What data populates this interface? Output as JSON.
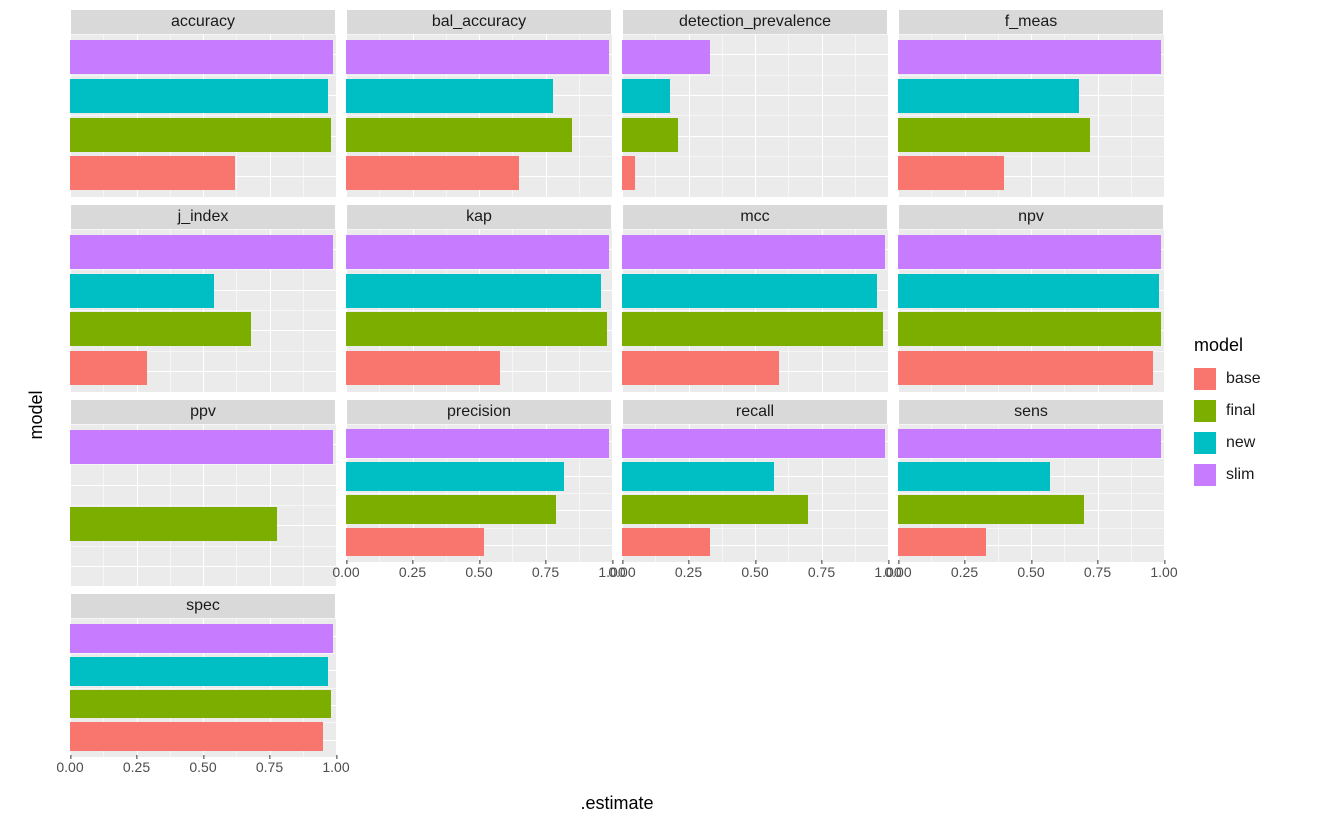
{
  "axis": {
    "x_label": ".estimate",
    "y_label": "model",
    "x_ticks": [
      "0.00",
      "0.25",
      "0.50",
      "0.75",
      "1.00"
    ]
  },
  "legend": {
    "title": "model",
    "items": [
      {
        "name": "base",
        "color": "#F8766D"
      },
      {
        "name": "final",
        "color": "#7CAE00"
      },
      {
        "name": "new",
        "color": "#00BFC4"
      },
      {
        "name": "slim",
        "color": "#C77CFF"
      }
    ]
  },
  "models_order": [
    "base",
    "final",
    "new",
    "slim"
  ],
  "colors": {
    "base": "#F8766D",
    "final": "#7CAE00",
    "new": "#00BFC4",
    "slim": "#C77CFF"
  },
  "chart_data": {
    "type": "bar",
    "facet_layout": {
      "rows": 4,
      "cols": 4
    },
    "xlim": [
      0.0,
      1.0
    ],
    "facets": [
      {
        "title": "accuracy",
        "values": {
          "base": 0.62,
          "final": 0.98,
          "new": 0.97,
          "slim": 0.99
        }
      },
      {
        "title": "bal_accuracy",
        "values": {
          "base": 0.65,
          "final": 0.85,
          "new": 0.78,
          "slim": 0.99
        }
      },
      {
        "title": "detection_prevalence",
        "values": {
          "base": 0.05,
          "final": 0.21,
          "new": 0.18,
          "slim": 0.33
        }
      },
      {
        "title": "f_meas",
        "values": {
          "base": 0.4,
          "final": 0.72,
          "new": 0.68,
          "slim": 0.99
        }
      },
      {
        "title": "j_index",
        "values": {
          "base": 0.29,
          "final": 0.68,
          "new": 0.54,
          "slim": 0.99
        }
      },
      {
        "title": "kap",
        "values": {
          "base": 0.58,
          "final": 0.98,
          "new": 0.96,
          "slim": 0.99
        }
      },
      {
        "title": "mcc",
        "values": {
          "base": 0.59,
          "final": 0.98,
          "new": 0.96,
          "slim": 0.99
        }
      },
      {
        "title": "npv",
        "values": {
          "base": 0.96,
          "final": 0.99,
          "new": 0.98,
          "slim": 0.99
        }
      },
      {
        "title": "ppv",
        "values": {
          "base": 0.0,
          "final": 0.78,
          "new": 0.0,
          "slim": 0.99
        }
      },
      {
        "title": "precision",
        "values": {
          "base": 0.52,
          "final": 0.79,
          "new": 0.82,
          "slim": 0.99
        }
      },
      {
        "title": "recall",
        "values": {
          "base": 0.33,
          "final": 0.7,
          "new": 0.57,
          "slim": 0.99
        }
      },
      {
        "title": "sens",
        "values": {
          "base": 0.33,
          "final": 0.7,
          "new": 0.57,
          "slim": 0.99
        }
      },
      {
        "title": "spec",
        "values": {
          "base": 0.95,
          "final": 0.98,
          "new": 0.97,
          "slim": 0.99
        }
      }
    ]
  }
}
